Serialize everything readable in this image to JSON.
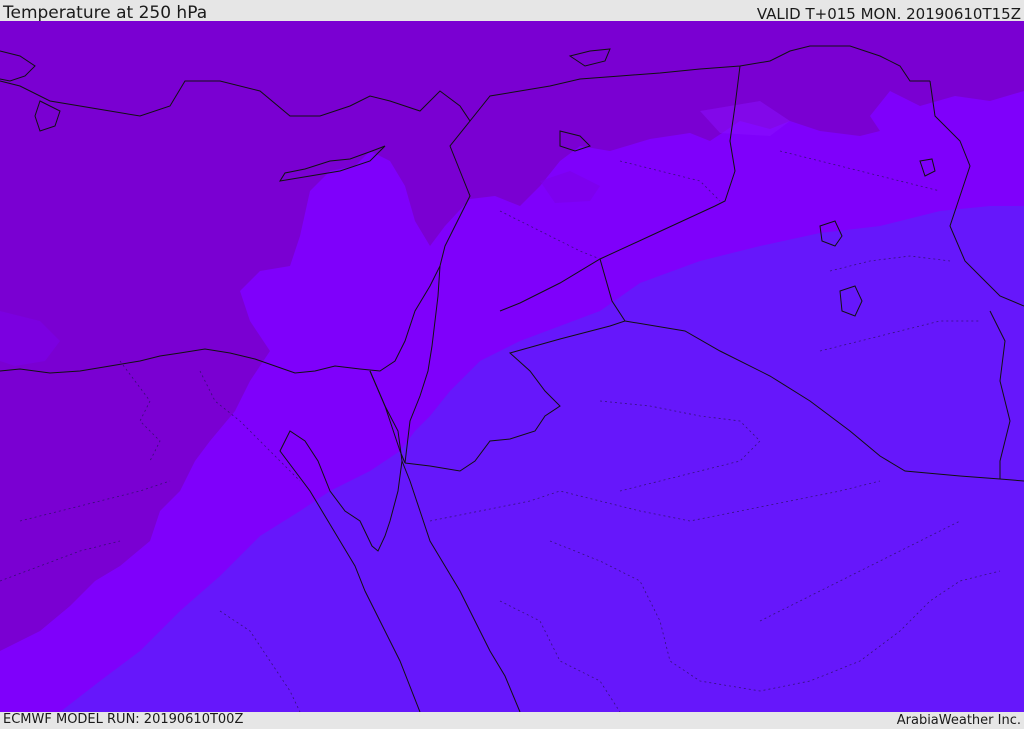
{
  "header": {
    "title": "Temperature at 250 hPa",
    "valid_time": "VALID T+015 MON. 20190610T15Z"
  },
  "footer": {
    "model_run": "ECMWF MODEL RUN: 20190610T00Z",
    "credit": "ArabiaWeather Inc."
  },
  "map": {
    "field": "temperature",
    "level": "250 hPa",
    "colors": {
      "cold_west": "#7a00d2",
      "mid_band": "#7f00fb",
      "warm_east": "#6617fb",
      "coastline": "#111111",
      "border": "#222222"
    }
  }
}
